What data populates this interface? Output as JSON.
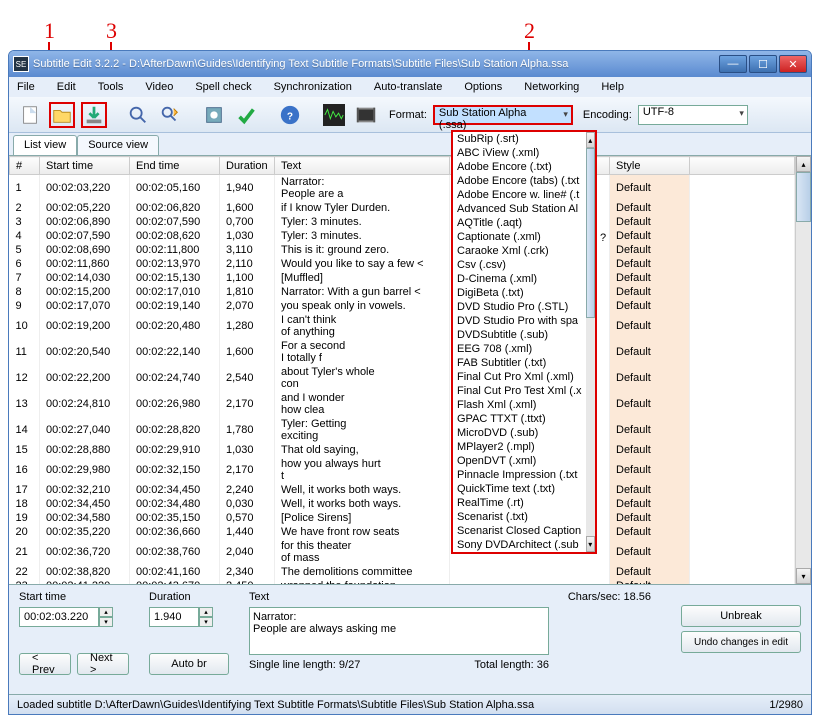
{
  "annotations": {
    "a1": "1",
    "a2": "2",
    "a3": "3"
  },
  "titlebar": {
    "icon": "SE",
    "text": "Subtitle Edit 3.2.2 - D:\\AfterDawn\\Guides\\Identifying Text Subtitle Formats\\Subtitle Files\\Sub Station Alpha.ssa",
    "min": "—",
    "max": "☐",
    "close": "✕"
  },
  "menu": [
    "File",
    "Edit",
    "Tools",
    "Video",
    "Spell check",
    "Synchronization",
    "Auto-translate",
    "Options",
    "Networking",
    "Help"
  ],
  "toolbar": {
    "format_label": "Format:",
    "format_value": "Sub Station Alpha (.ssa)",
    "encoding_label": "Encoding:",
    "encoding_value": "UTF-8"
  },
  "tabs": {
    "list": "List view",
    "source": "Source view"
  },
  "columns": [
    "#",
    "Start time",
    "End time",
    "Duration",
    "Text",
    "Style"
  ],
  "rows": [
    {
      "n": "1",
      "st": "00:02:03,220",
      "et": "00:02:05,160",
      "d": "1,940",
      "tx": "Narrator: <br />People are a",
      "sty": "Default"
    },
    {
      "n": "2",
      "st": "00:02:05,220",
      "et": "00:02:06,820",
      "d": "1,600",
      "tx": "if I know Tyler Durden.",
      "sty": "Default"
    },
    {
      "n": "3",
      "st": "00:02:06,890",
      "et": "00:02:07,590",
      "d": "0,700",
      "tx": "Tyler: 3 minutes.",
      "sty": "Default"
    },
    {
      "n": "4",
      "st": "00:02:07,590",
      "et": "00:02:08,620",
      "d": "1,030",
      "tx": "Tyler: 3 minutes.",
      "sty": "Default"
    },
    {
      "n": "5",
      "st": "00:02:08,690",
      "et": "00:02:11,800",
      "d": "3,110",
      "tx": "This is it: ground zero.",
      "sty": "Default"
    },
    {
      "n": "6",
      "st": "00:02:11,860",
      "et": "00:02:13,970",
      "d": "2,110",
      "tx": "Would you like to say a few <",
      "sty": "Default"
    },
    {
      "n": "7",
      "st": "00:02:14,030",
      "et": "00:02:15,130",
      "d": "1,100",
      "tx": "[Muffled]",
      "sty": "Default"
    },
    {
      "n": "8",
      "st": "00:02:15,200",
      "et": "00:02:17,010",
      "d": "1,810",
      "tx": "Narrator: With a gun barrel <",
      "sty": "Default"
    },
    {
      "n": "9",
      "st": "00:02:17,070",
      "et": "00:02:19,140",
      "d": "2,070",
      "tx": "you speak only in vowels.",
      "sty": "Default"
    },
    {
      "n": "10",
      "st": "00:02:19,200",
      "et": "00:02:20,480",
      "d": "1,280",
      "tx": "I can't think<br />of anything",
      "sty": "Default"
    },
    {
      "n": "11",
      "st": "00:02:20,540",
      "et": "00:02:22,140",
      "d": "1,600",
      "tx": "For a second<br />I totally f",
      "sty": "Default"
    },
    {
      "n": "12",
      "st": "00:02:22,200",
      "et": "00:02:24,740",
      "d": "2,540",
      "tx": "about Tyler's whole<br />con",
      "sty": "Default"
    },
    {
      "n": "13",
      "st": "00:02:24,810",
      "et": "00:02:26,980",
      "d": "2,170",
      "tx": "and I wonder <br />how clea",
      "sty": "Default"
    },
    {
      "n": "14",
      "st": "00:02:27,040",
      "et": "00:02:28,820",
      "d": "1,780",
      "tx": "Tyler: Getting<br />exciting",
      "sty": "Default"
    },
    {
      "n": "15",
      "st": "00:02:28,880",
      "et": "00:02:29,910",
      "d": "1,030",
      "tx": "That old saying,",
      "sty": "Default"
    },
    {
      "n": "16",
      "st": "00:02:29,980",
      "et": "00:02:32,150",
      "d": "2,170",
      "tx": "how you always hurt<br />t",
      "sty": "Default"
    },
    {
      "n": "17",
      "st": "00:02:32,210",
      "et": "00:02:34,450",
      "d": "2,240",
      "tx": "Well, it works both ways.",
      "sty": "Default"
    },
    {
      "n": "18",
      "st": "00:02:34,450",
      "et": "00:02:34,480",
      "d": "0,030",
      "tx": "Well, it works both ways.",
      "sty": "Default"
    },
    {
      "n": "19",
      "st": "00:02:34,580",
      "et": "00:02:35,150",
      "d": "0,570",
      "tx": "[Police Sirens]",
      "sty": "Default"
    },
    {
      "n": "20",
      "st": "00:02:35,220",
      "et": "00:02:36,660",
      "d": "1,440",
      "tx": "We have front row seats",
      "sty": "Default"
    },
    {
      "n": "21",
      "st": "00:02:36,720",
      "et": "00:02:38,760",
      "d": "2,040",
      "tx": "for this theater<br />of mass",
      "sty": "Default"
    },
    {
      "n": "22",
      "st": "00:02:38,820",
      "et": "00:02:41,160",
      "d": "2,340",
      "tx": "The demolitions committee<b",
      "sty": "Default"
    },
    {
      "n": "23",
      "st": "00:02:41,220",
      "et": "00:02:43,670",
      "d": "2,450",
      "tx": "wrapped the foundation<br /",
      "sty": "Default"
    }
  ],
  "dropdown": [
    "SubRip (.srt)",
    "ABC iView (.xml)",
    "Adobe Encore (.txt)",
    "Adobe Encore (tabs) (.txt",
    "Adobe Encore w. line# (.t",
    "Advanced Sub Station Al",
    "AQTitle (.aqt)",
    "Captionate (.xml)",
    "Caraoke Xml (.crk)",
    "Csv (.csv)",
    "D-Cinema (.xml)",
    "DigiBeta (.txt)",
    "DVD Studio Pro (.STL)",
    "DVD Studio Pro with spa",
    "DVDSubtitle (.sub)",
    "EEG 708 (.xml)",
    "FAB Subtitler (.txt)",
    "Final Cut Pro Xml (.xml)",
    "Final Cut Pro Test Xml (.x",
    "Flash Xml (.xml)",
    "GPAC TTXT (.ttxt)",
    "MicroDVD (.sub)",
    "MPlayer2 (.mpl)",
    "OpenDVT (.xml)",
    "Pinnacle Impression (.txt",
    "QuickTime text (.txt)",
    "RealTime (.rt)",
    "Scenarist (.txt)",
    "Scenarist Closed Caption",
    "Sony DVDArchitect (.sub"
  ],
  "truncated_text": "?",
  "bottom": {
    "start_label": "Start time",
    "start_value": "00:02:03.220",
    "dur_label": "Duration",
    "dur_value": "1.940",
    "text_label": "Text",
    "text_value": "Narrator:\nPeople are always asking me",
    "chars_label": "Chars/sec: 18.56",
    "single_label": "Single line length:  9/27",
    "total_label": "Total length: 36",
    "prev": "< Prev",
    "next": "Next >",
    "autobr": "Auto br",
    "unbreak": "Unbreak",
    "undo": "Undo changes in edit"
  },
  "status": {
    "left": "Loaded subtitle D:\\AfterDawn\\Guides\\Identifying Text Subtitle Formats\\Subtitle Files\\Sub Station Alpha.ssa",
    "right": "1/2980"
  }
}
